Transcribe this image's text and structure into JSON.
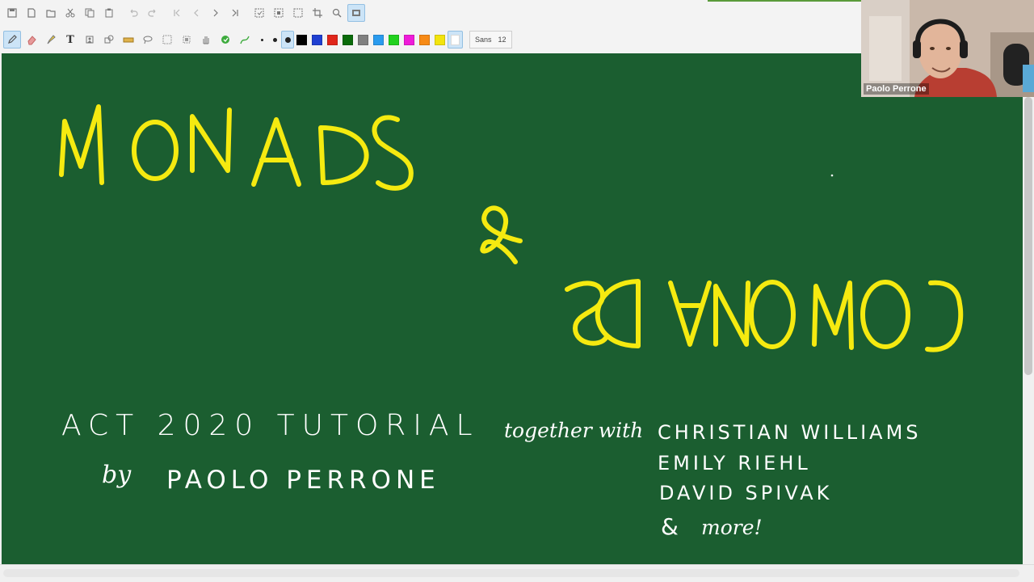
{
  "toolbar": {
    "row1_icons": [
      "save-icon",
      "new-page-icon",
      "open-icon",
      "cut-icon",
      "copy-icon",
      "paste-icon",
      "undo-icon",
      "redo-icon",
      "first-page-icon",
      "prev-page-icon",
      "next-page-icon",
      "last-page-icon",
      "select-all-icon",
      "select-icon",
      "select-region-icon",
      "crop-icon",
      "zoom-icon",
      "fit-icon"
    ],
    "row2_tools": [
      "pen-icon",
      "eraser-icon",
      "highlighter-icon",
      "text-icon",
      "stamp-icon",
      "shape-icon",
      "ruler-icon",
      "lasso-icon",
      "pattern-icon",
      "region-icon",
      "hand-icon",
      "fill-icon",
      "spline-icon"
    ],
    "colors": [
      "#000000",
      "#1f3fd1",
      "#e0261b",
      "#0b6b0b",
      "#808080",
      "#2a9bee",
      "#22d11f",
      "#ef1bd9",
      "#f78a16",
      "#f3e40d",
      "#ffffff"
    ],
    "selected_color": "#ffffff",
    "font_name": "Sans",
    "font_size": "12"
  },
  "board": {
    "background": "#1b5e30",
    "title_monads": "MONADS",
    "ampersand": "&",
    "title_comonads_mirrored": "COMONADS",
    "subtitle_line1": "ACT 2020 TUTORIAL",
    "subtitle_by": "by",
    "subtitle_author": "PAOLO PERRONE",
    "together_with": "together with",
    "collaborators": [
      "CHRISTIAN WILLIAMS",
      "EMILY RIEHL",
      "DAVID SPIVAK"
    ],
    "and_more_amp": "&",
    "and_more": "more!"
  },
  "webcam": {
    "name": "Paolo Perrone"
  }
}
